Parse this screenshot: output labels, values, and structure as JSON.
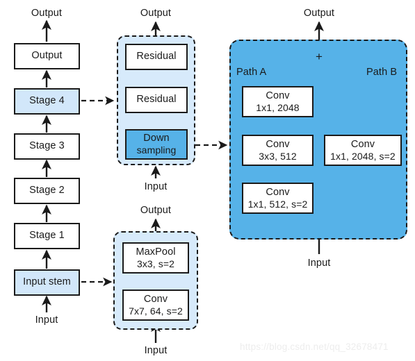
{
  "diagram": {
    "title": "ResNet architecture breakdown diagram",
    "colors": {
      "light_blue": "#d2e7fa",
      "medium_blue": "#56b2e8",
      "group_fill": "#d7eafb",
      "stroke": "#1a1a1a",
      "watermark": "#ededed"
    },
    "watermark": "https://blog.csdn.net/qq_32678471"
  },
  "backbone": {
    "top_label": "Output",
    "bottom_label": "Input",
    "blocks": [
      {
        "label": "Output",
        "highlight": "none"
      },
      {
        "label": "Stage 4",
        "highlight": "light"
      },
      {
        "label": "Stage 3",
        "highlight": "none"
      },
      {
        "label": "Stage 2",
        "highlight": "none"
      },
      {
        "label": "Stage 1",
        "highlight": "none"
      },
      {
        "label": "Input stem",
        "highlight": "light"
      }
    ]
  },
  "stage_detail": {
    "top_label": "Output",
    "bottom_label": "Input",
    "blocks": [
      {
        "label": "Residual",
        "highlight": "none"
      },
      {
        "label": "Residual",
        "highlight": "none"
      },
      {
        "line1": "Down",
        "line2": "sampling",
        "highlight": "medium"
      }
    ]
  },
  "stem_detail": {
    "top_label": "Output",
    "bottom_label": "Input",
    "blocks": [
      {
        "line1": "MaxPool",
        "line2": "3x3, s=2"
      },
      {
        "line1": "Conv",
        "line2": "7x7, 64, s=2"
      }
    ]
  },
  "downsampling_detail": {
    "top_label": "Output",
    "bottom_label": "Input",
    "path_a_label": "Path A",
    "path_b_label": "Path B",
    "sum_symbol": "+",
    "path_a": [
      {
        "line1": "Conv",
        "line2": "1x1, 2048"
      },
      {
        "line1": "Conv",
        "line2": "3x3, 512"
      },
      {
        "line1": "Conv",
        "line2": "1x1, 512, s=2"
      }
    ],
    "path_b": [
      {
        "line1": "Conv",
        "line2": "1x1, 2048, s=2"
      }
    ]
  }
}
